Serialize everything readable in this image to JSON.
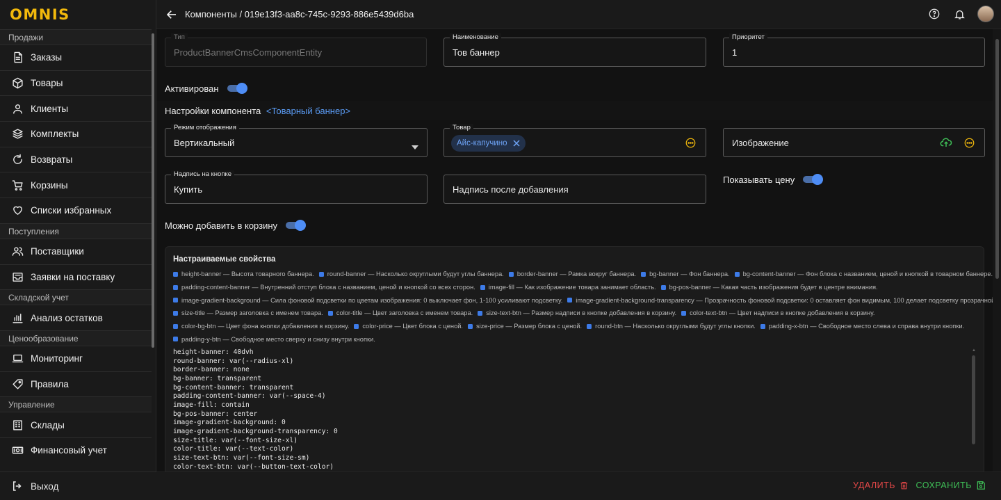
{
  "app": {
    "logo": "OMNIS"
  },
  "header": {
    "breadcrumb": "Компоненты / 019e13f3-aa8c-745c-9293-886e5439d6ba"
  },
  "sidebar": {
    "sections": [
      {
        "title": "Продажи",
        "items": [
          {
            "label": "Заказы",
            "icon": "document-icon"
          },
          {
            "label": "Товары",
            "icon": "box-icon"
          },
          {
            "label": "Клиенты",
            "icon": "user-icon"
          },
          {
            "label": "Комплекты",
            "icon": "layers-icon"
          },
          {
            "label": "Возвраты",
            "icon": "refresh-icon"
          },
          {
            "label": "Корзины",
            "icon": "cart-icon"
          },
          {
            "label": "Списки избранных",
            "icon": "heart-icon"
          }
        ]
      },
      {
        "title": "Поступления",
        "items": [
          {
            "label": "Поставщики",
            "icon": "users-icon"
          },
          {
            "label": "Заявки на поставку",
            "icon": "inbox-icon"
          }
        ]
      },
      {
        "title": "Складской учет",
        "items": [
          {
            "label": "Анализ остатков",
            "icon": "bar-chart-icon"
          }
        ]
      },
      {
        "title": "Ценообразование",
        "items": [
          {
            "label": "Мониторинг",
            "icon": "laptop-icon"
          },
          {
            "label": "Правила",
            "icon": "tag-icon"
          }
        ]
      },
      {
        "title": "Управление",
        "items": [
          {
            "label": "Склады",
            "icon": "building-icon"
          },
          {
            "label": "Финансовый учет",
            "icon": "money-icon"
          }
        ]
      }
    ],
    "logout": "Выход"
  },
  "form": {
    "type": {
      "label": "Тип",
      "value": "ProductBannerCmsComponentEntity"
    },
    "name": {
      "label": "Наименование",
      "value": "Тов баннер"
    },
    "priority": {
      "label": "Приоритет",
      "value": "1"
    },
    "active": {
      "label": "Активирован",
      "on": true
    },
    "settings_title": "Настройки компонента",
    "settings_link": "<Товарный баннер>",
    "display_mode": {
      "label": "Режим отображения",
      "value": "Вертикальный"
    },
    "product": {
      "label": "Товар",
      "chip": "Айс-капучино"
    },
    "image": {
      "placeholder": "Изображение"
    },
    "button_label": {
      "label": "Надпись на кнопке",
      "value": "Купить"
    },
    "after_add": {
      "placeholder": "Надпись после добавления"
    },
    "show_price": {
      "label": "Показывать цену",
      "on": true
    },
    "can_add": {
      "label": "Можно добавить в корзину",
      "on": true
    }
  },
  "props": {
    "title": "Настраиваемые свойства",
    "legend_lines": [
      [
        "height-banner — Высота товарного баннера.",
        "round-banner — Насколько округлыми будут углы баннера.",
        "border-banner — Рамка вокруг баннера.",
        "bg-banner — Фон баннера.",
        "bg-content-banner — Фон блока с названием, ценой и кнопкой в товарном баннере."
      ],
      [
        "padding-content-banner — Внутренний отступ блока с названием, ценой и кнопкой со всех сторон.",
        "image-fill — Как изображение товара занимает область.",
        "bg-pos-banner — Какая часть изображения будет в центре внимания."
      ],
      [
        "image-gradient-background — Сила фоновой подсветки по цветам изображения: 0 выключает фон, 1-100 усиливают подсветку.",
        "image-gradient-background-transparency — Прозрачность фоновой подсветки: 0 оставляет фон видимым, 100 делает подсветку прозрачной."
      ],
      [
        "size-title — Размер заголовка с именем товара.",
        "color-title — Цвет заголовка с именем товара.",
        "size-text-btn — Размер надписи в кнопке добавления в корзину.",
        "color-text-btn — Цвет надписи в кнопке добавления в корзину."
      ],
      [
        "color-bg-btn — Цвет фона кнопки добавления в корзину.",
        "color-price — Цвет блока с ценой.",
        "size-price — Размер блока с ценой.",
        "round-btn — Насколько округлыми будут углы кнопки.",
        "padding-x-btn — Свободное место слева и справа внутри кнопки."
      ],
      [
        "padding-y-btn — Свободное место сверху и снизу внутри кнопки."
      ]
    ],
    "code": "height-banner: 40dvh\nround-banner: var(--radius-xl)\nborder-banner: none\nbg-banner: transparent\nbg-content-banner: transparent\npadding-content-banner: var(--space-4)\nimage-fill: contain\nbg-pos-banner: center\nimage-gradient-background: 0\nimage-gradient-background-transparency: 0\nsize-title: var(--font-size-xl)\ncolor-title: var(--text-color)\nsize-text-btn: var(--font-size-sm)\ncolor-text-btn: var(--button-text-color)"
  },
  "footer": {
    "delete": "УДАЛИТЬ",
    "save": "СОХРАНИТЬ"
  },
  "colors": {
    "accent": "#4e8df5",
    "logo": "#f2b90c",
    "danger": "#e54848",
    "success": "#3fbf57",
    "warning": "#f2b90c"
  }
}
